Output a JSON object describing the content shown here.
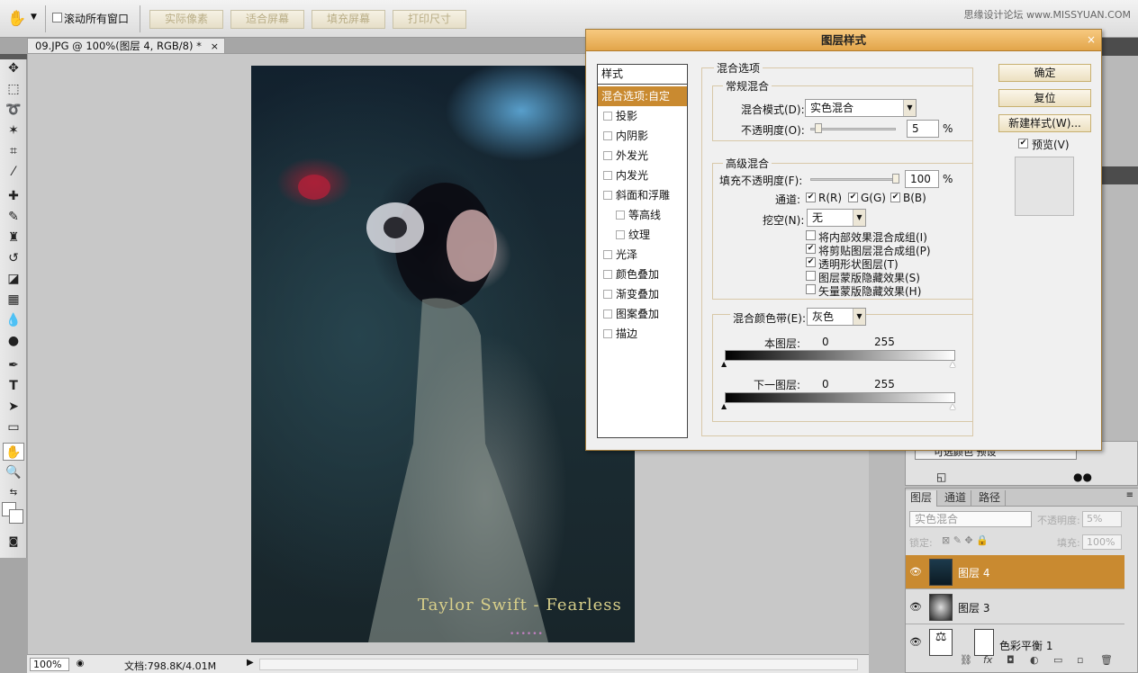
{
  "options_bar": {
    "scroll_all_label": "滚动所有窗口",
    "buttons": [
      "实际像素",
      "适合屏幕",
      "填充屏幕",
      "打印尺寸"
    ],
    "watermark": "思缘设计论坛 www.MISSYUAN.COM"
  },
  "document": {
    "tab_title": "09.JPG @ 100%(图层 4, RGB/8) *",
    "close": "×",
    "caption": "Taylor Swift - Fearless",
    "dots": "••••••"
  },
  "status": {
    "zoom": "100%",
    "doc_info": "文档:798.8K/4.01M"
  },
  "dialog": {
    "title": "图层样式",
    "close": "×",
    "styles_header": "样式",
    "styles": [
      {
        "label": "混合选项:自定",
        "checkbox": false,
        "active": true,
        "indent": false
      },
      {
        "label": "投影",
        "checkbox": true,
        "indent": false
      },
      {
        "label": "内阴影",
        "checkbox": true,
        "indent": false
      },
      {
        "label": "外发光",
        "checkbox": true,
        "indent": false
      },
      {
        "label": "内发光",
        "checkbox": true,
        "indent": false
      },
      {
        "label": "斜面和浮雕",
        "checkbox": true,
        "indent": false
      },
      {
        "label": "等高线",
        "checkbox": true,
        "indent": true
      },
      {
        "label": "纹理",
        "checkbox": true,
        "indent": true
      },
      {
        "label": "光泽",
        "checkbox": true,
        "indent": false
      },
      {
        "label": "颜色叠加",
        "checkbox": true,
        "indent": false
      },
      {
        "label": "渐变叠加",
        "checkbox": true,
        "indent": false
      },
      {
        "label": "图案叠加",
        "checkbox": true,
        "indent": false
      },
      {
        "label": "描边",
        "checkbox": true,
        "indent": false
      }
    ],
    "blend_options_title": "混合选项",
    "general": {
      "title": "常规混合",
      "mode_label": "混合模式(D):",
      "mode_value": "实色混合",
      "opacity_label": "不透明度(O):",
      "opacity_value": "5",
      "opacity_percent": 5,
      "unit": "%"
    },
    "advanced": {
      "title": "高级混合",
      "fill_label": "填充不透明度(F):",
      "fill_value": "100",
      "fill_percent": 100,
      "unit": "%",
      "channels_label": "通道:",
      "channels": [
        {
          "label": "R(R)",
          "checked": true
        },
        {
          "label": "G(G)",
          "checked": true
        },
        {
          "label": "B(B)",
          "checked": true
        }
      ],
      "knockout_label": "挖空(N):",
      "knockout_value": "无",
      "options": [
        {
          "label": "将内部效果混合成组(I)",
          "checked": false
        },
        {
          "label": "将剪贴图层混合成组(P)",
          "checked": true
        },
        {
          "label": "透明形状图层(T)",
          "checked": true
        },
        {
          "label": "图层蒙版隐藏效果(S)",
          "checked": false
        },
        {
          "label": "矢量蒙版隐藏效果(H)",
          "checked": false
        }
      ]
    },
    "blend_if": {
      "label": "混合颜色带(E):",
      "value": "灰色",
      "this_layer_label": "本图层:",
      "this_layer_min": "0",
      "this_layer_max": "255",
      "underlying_label": "下一图层:",
      "underlying_min": "0",
      "underlying_max": "255"
    },
    "buttons": {
      "ok": "确定",
      "reset": "复位",
      "new_style": "新建样式(W)...",
      "preview_label": "预览(V)",
      "preview_checked": true
    }
  },
  "actions_panel": {
    "item": "可选颜色 预设"
  },
  "layers_panel": {
    "tabs": [
      "图层",
      "通道",
      "路径"
    ],
    "blend_mode": "实色混合",
    "opacity_label": "不透明度:",
    "opacity_value": "5%",
    "lock_label": "锁定:",
    "fill_label": "填充:",
    "fill_value": "100%",
    "layers": [
      {
        "name": "图层 4",
        "selected": true
      },
      {
        "name": "图层 3",
        "selected": false
      },
      {
        "name": "色彩平衡 1",
        "selected": false
      }
    ]
  },
  "colors": {
    "accent": "#c98a30",
    "dialog_title": "#e2a54a"
  }
}
